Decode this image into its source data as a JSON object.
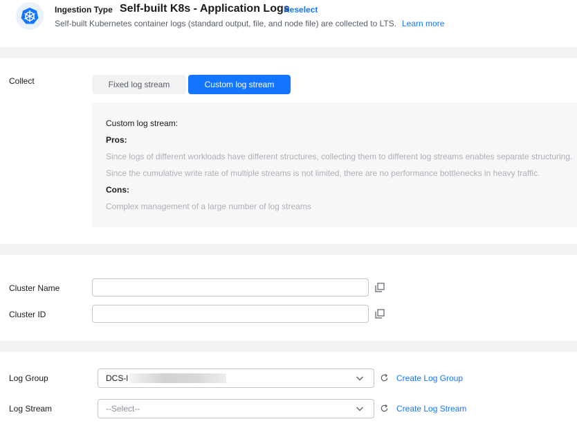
{
  "header": {
    "icon": "kubernetes-icon",
    "ingestion_label": "Ingestion Type",
    "title": "Self-built K8s - Application Logs",
    "reselect": "Reselect",
    "description": "Self-built Kubernetes container logs (standard output, file, and node file) are collected to LTS.",
    "learn_more": "Learn more"
  },
  "collect": {
    "label": "Collect",
    "options": [
      "Fixed log stream",
      "Custom log stream"
    ],
    "selected": "Custom log stream",
    "info": {
      "heading": "Custom log stream:",
      "pros_label": "Pros:",
      "pros": [
        "Since logs of different workloads have different structures, collecting them to different log streams enables separate structuring.",
        "Since the cumulative write rate of multiple streams is not limited, there are no performance bottlenecks in heavy traffic."
      ],
      "cons_label": "Cons:",
      "cons": [
        "Complex management of a large number of log streams"
      ]
    }
  },
  "cluster": {
    "name_label": "Cluster Name",
    "name_value": "",
    "id_label": "Cluster ID",
    "id_value": ""
  },
  "log": {
    "group_label": "Log Group",
    "group_value": "DCS-l",
    "group_link": "Create Log Group",
    "stream_label": "Log Stream",
    "stream_placeholder": "--Select--",
    "stream_link": "Create Log Stream"
  },
  "colors": {
    "accent": "#1476ff",
    "band": "#f2f2f2",
    "panel": "#f7f7f7"
  }
}
